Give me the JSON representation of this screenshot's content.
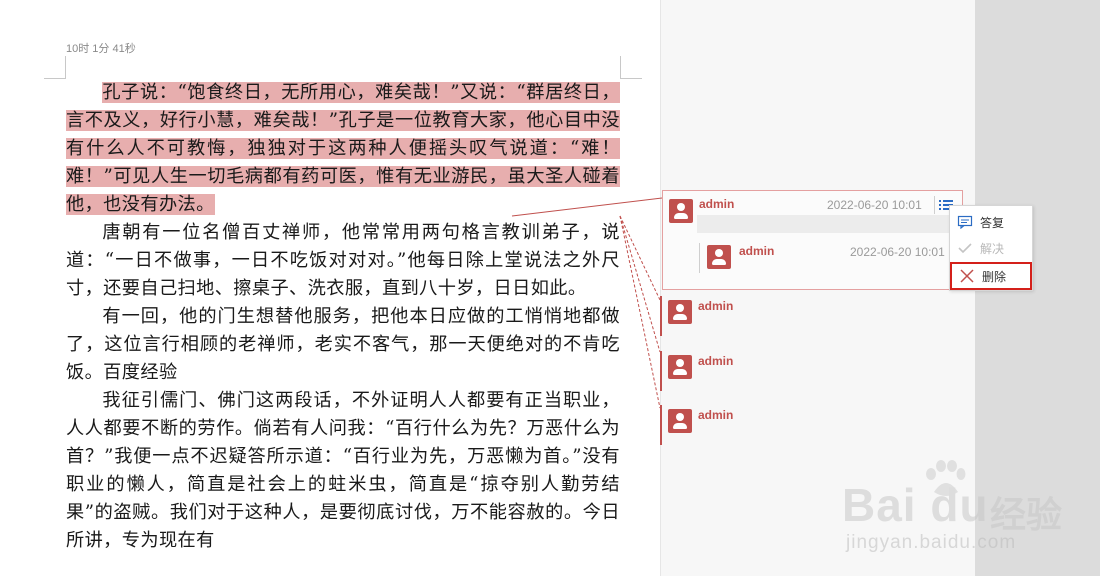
{
  "document": {
    "timestamp": "10时 1分 41秒",
    "paragraphs": [
      {
        "highlighted": "孔子说：“饱食终日，无所用心，难矣哉！”又说：“群居终日，言不及义，好行小慧，难矣哉！”孔子是一位教育大家，他心目中没有什么人不可教悔，独独对于这两种人便摇头叹气说道：“难！难！”可见人生一切毛病都有药可医，惟有无业游民，虽大圣人碰着他，也没有办法。",
        "rest": ""
      },
      {
        "highlighted": "",
        "rest": "唐朝有一位名僧百丈禅师，他常常用两句格言教训弟子，说道：“一日不做事，一日不吃饭对对对。”他每日除上堂说法之外尺寸，还要自己扫地、擦桌子、洗衣服，直到八十岁，日日如此。"
      },
      {
        "highlighted": "",
        "rest": "有一回，他的门生想替他服务，把他本日应做的工悄悄地都做了，这位言行相顾的老禅师，老实不客气，那一天便绝对的不肯吃饭。百度经验"
      },
      {
        "highlighted": "",
        "rest": "我征引儒门、佛门这两段话，不外证明人人都要有正当职业，人人都要不断的劳作。倘若有人问我：“百行什么为先？万恶什么为首？”我便一点不迟疑答所示道：“百行业为先，万恶懒为首。”没有职业的懒人，简直是社会上的蛀米虫，简直是“掠夺别人勤劳结果”的盗贼。我们对于这种人，是要彻底讨伐，万不能容赦的。今日所讲，专为现在有"
      }
    ]
  },
  "comments": {
    "active": {
      "author": "admin",
      "time": "2022-06-20 10:01",
      "reply": {
        "author": "admin",
        "time": "2022-06-20 10:01"
      }
    },
    "others": [
      {
        "author": "admin"
      },
      {
        "author": "admin"
      },
      {
        "author": "admin"
      }
    ]
  },
  "context_menu": {
    "reply_label": "答复",
    "resolve_label": "解决",
    "delete_label": "删除"
  },
  "watermark": {
    "brand": "Bai du",
    "brand_cn": "经验",
    "url": "jingyan.baidu.com"
  },
  "colors": {
    "highlight": "#e7aeae",
    "comment_accent": "#c0504d",
    "delete_border": "#d4201a"
  }
}
